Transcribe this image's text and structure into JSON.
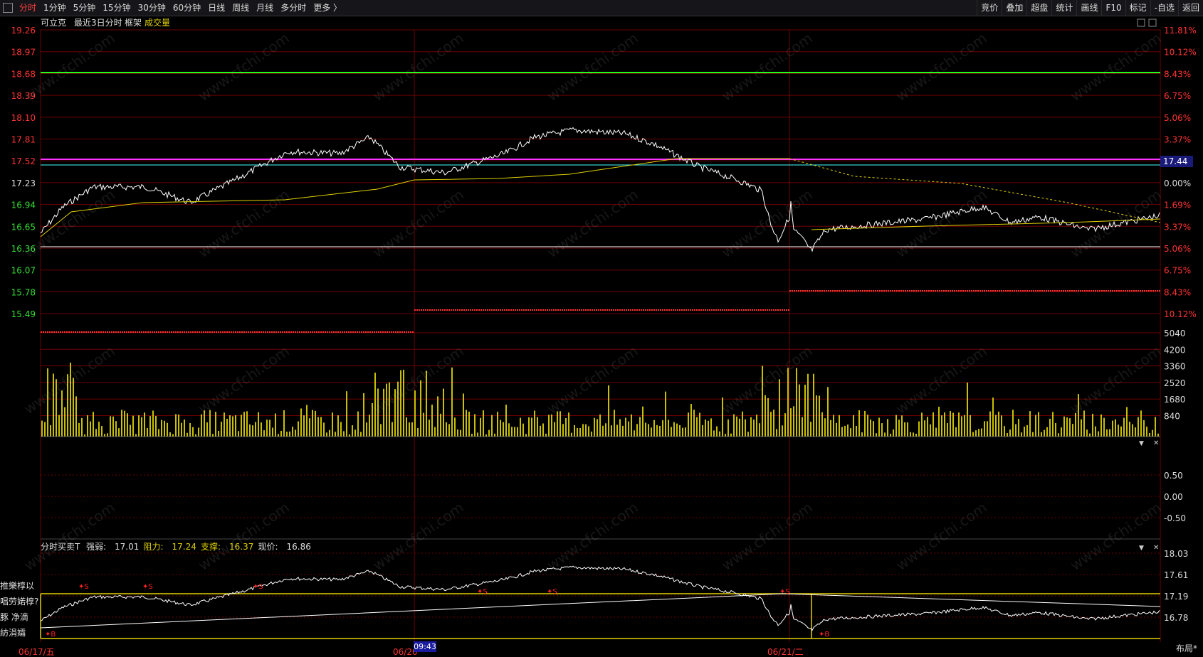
{
  "toolbar": {
    "left": [
      "分时",
      "1分钟",
      "5分钟",
      "15分钟",
      "30分钟",
      "60分钟",
      "日线",
      "周线",
      "月线",
      "多分时",
      "更多 〉"
    ],
    "active_index": 0,
    "right": [
      "竞价",
      "叠加",
      "超盘",
      "统计",
      "画线",
      "F10",
      "标记",
      "-自选",
      "返回"
    ]
  },
  "header": {
    "stock_name": "可立克",
    "period": "最近3日分时",
    "frame": "框架",
    "volume_label": "成交量"
  },
  "price_axis": {
    "left": [
      "19.26",
      "18.97",
      "18.68",
      "18.39",
      "18.10",
      "17.81",
      "17.52",
      "17.23",
      "16.94",
      "16.65",
      "16.36",
      "16.07",
      "15.78",
      "15.49"
    ],
    "right": [
      "11.81%",
      "10.12%",
      "8.43%",
      "6.75%",
      "5.06%",
      "3.37%",
      "1.69%",
      "0.00%",
      "1.69%",
      "3.37%",
      "5.06%",
      "6.75%",
      "8.43%",
      "10.12%"
    ],
    "current_tag": "17.44"
  },
  "volume_axis": [
    "5040",
    "4200",
    "3360",
    "2520",
    "1680",
    "840"
  ],
  "sub_axis": [
    "0.50",
    "0.00",
    "-0.50"
  ],
  "indicator": {
    "name": "分时买卖T",
    "strong_weak_label": "强弱:",
    "strong_weak": "17.01",
    "resist_label": "阻力:",
    "resist": "17.24",
    "support_label": "支撑:",
    "support": "16.37",
    "price_label": "现价:",
    "price": "16.86",
    "axis": [
      "18.03",
      "17.61",
      "17.19",
      "16.78"
    ]
  },
  "side_labels": [
    "推樂椁以",
    "唱劳婼椁?",
    "豚 净滴",
    "紡涓孀"
  ],
  "dates": [
    "06/17/五",
    "06/20",
    "06/21/二"
  ],
  "cursor_time": "09:43",
  "layout_button": "布局*",
  "watermark": "www.cfchi.com",
  "colors": {
    "grid": "#6e0000",
    "up": "#ff3333",
    "down": "#33dd33",
    "price_line": "#ffffff",
    "avg_line": "#e0d000",
    "volume": "#c8c000",
    "magenta": "#ff33ff",
    "cyan": "#44ffff",
    "green": "#22ff22"
  }
}
